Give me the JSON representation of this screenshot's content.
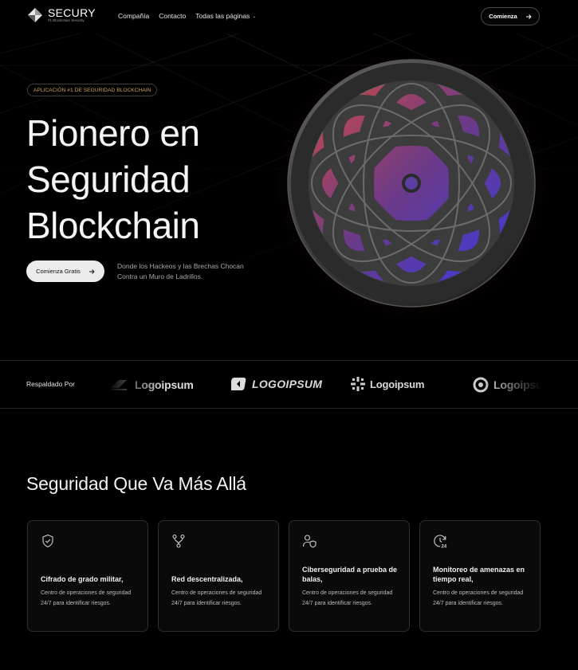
{
  "brand": {
    "name": "SECURY",
    "tagline": "#1 Blockchain Security"
  },
  "nav": {
    "links": [
      "Compañía",
      "Contacto",
      "Todas las páginas"
    ],
    "cta_label": "Comienza"
  },
  "hero": {
    "badge": "APLICACIÓN #1 DE SEGURIDAD BLOCKCHAIN",
    "title_lines": [
      "Pionero en",
      "Seguridad",
      "Blockchain"
    ],
    "cta_label": "Comienza Gratis",
    "description": "Donde los Hackeos y las Brechas Chocan Contra un Muro de Ladrillos."
  },
  "partners": {
    "label": "Respaldado Por",
    "logos": [
      "Logoipsum",
      "LOGOIPSUM",
      "Logoipsum",
      "Logoipsum"
    ]
  },
  "features": {
    "title": "Seguridad Que Va Más Allá",
    "cards": [
      {
        "icon": "shield-check-icon",
        "title": "Cifrado de grado militar,",
        "desc": "Centro de operaciones de seguridad 24/7 para identificar riesgos."
      },
      {
        "icon": "git-branch-icon",
        "title": "Red descentralizada,",
        "desc": "Centro de operaciones de seguridad 24/7 para identificar riesgos."
      },
      {
        "icon": "user-shield-icon",
        "title": "Ciberseguridad a prueba de balas,",
        "desc": "Centro de operaciones de seguridad 24/7 para identificar riesgos."
      },
      {
        "icon": "clock-24-icon",
        "title": "Monitoreo de amenazas en tiempo real,",
        "desc": "Centro de operaciones de seguridad 24/7 para identificar riesgos."
      }
    ]
  },
  "colors": {
    "background": "#000000",
    "badge_text": "#d7a45a",
    "sphere_red": "#c8403c",
    "sphere_blue": "#3a3ad8"
  }
}
